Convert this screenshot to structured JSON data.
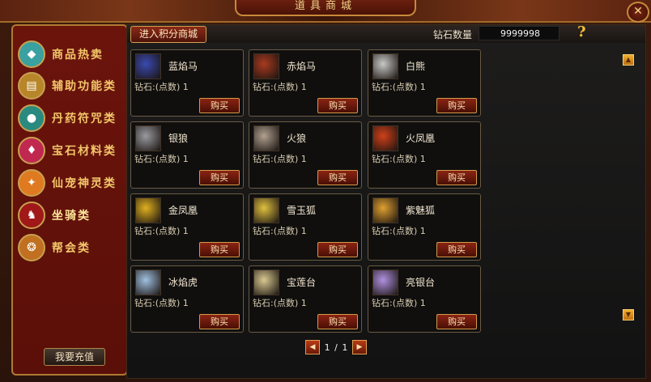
{
  "window": {
    "title": "道具商城",
    "close_glyph": "✕"
  },
  "sidebar": {
    "items": [
      {
        "label": "商品热卖",
        "icon": "gem-chest-icon",
        "color": "#3aa0a0"
      },
      {
        "label": "辅助功能类",
        "icon": "book-icon",
        "color": "#b8862a"
      },
      {
        "label": "丹药符咒类",
        "icon": "orb-icon",
        "color": "#2a8a80"
      },
      {
        "label": "宝石材料类",
        "icon": "gem-icon",
        "color": "#c02850"
      },
      {
        "label": "仙宠神灵类",
        "icon": "phoenix-pet-icon",
        "color": "#e07a20"
      },
      {
        "label": "坐骑类",
        "icon": "dragon-mount-icon",
        "color": "#a01818",
        "active": true
      },
      {
        "label": "帮会类",
        "icon": "bag-icon",
        "color": "#c07020"
      }
    ],
    "recharge_label": "我要充值"
  },
  "header": {
    "points_mall_label": "进入积分商城",
    "diamond_label": "钻石数量",
    "diamond_value": "9999998",
    "help_glyph": "?"
  },
  "items": [
    {
      "name": "蓝焰马",
      "price": "钻石:(点数) 1",
      "buy": "购买",
      "thumb": "blue-flame-horse-icon",
      "color": "#3a4ab0"
    },
    {
      "name": "赤焰马",
      "price": "钻石:(点数) 1",
      "buy": "购买",
      "thumb": "red-flame-horse-icon",
      "color": "#a83a20"
    },
    {
      "name": "白熊",
      "price": "钻石:(点数) 1",
      "buy": "购买",
      "thumb": "white-bear-icon",
      "color": "#c8c8c8"
    },
    {
      "name": "银狼",
      "price": "钻石:(点数) 1",
      "buy": "购买",
      "thumb": "silver-wolf-icon",
      "color": "#9a9aa0"
    },
    {
      "name": "火狼",
      "price": "钻石:(点数) 1",
      "buy": "购买",
      "thumb": "fire-wolf-icon",
      "color": "#b0a090"
    },
    {
      "name": "火凤凰",
      "price": "钻石:(点数) 1",
      "buy": "购买",
      "thumb": "fire-phoenix-icon",
      "color": "#d0401a"
    },
    {
      "name": "金凤凰",
      "price": "钻石:(点数) 1",
      "buy": "购买",
      "thumb": "golden-phoenix-icon",
      "color": "#e0b020"
    },
    {
      "name": "雪玉狐",
      "price": "钻石:(点数) 1",
      "buy": "购买",
      "thumb": "snow-fox-icon",
      "color": "#e0c040"
    },
    {
      "name": "紫魅狐",
      "price": "钻石:(点数) 1",
      "buy": "购买",
      "thumb": "purple-fox-icon",
      "color": "#e0a030"
    },
    {
      "name": "冰焰虎",
      "price": "钻石:(点数) 1",
      "buy": "购买",
      "thumb": "ice-tiger-icon",
      "color": "#a0c0e0"
    },
    {
      "name": "宝莲台",
      "price": "钻石:(点数) 1",
      "buy": "购买",
      "thumb": "lotus-platform-icon",
      "color": "#d8c890"
    },
    {
      "name": "亮银台",
      "price": "钻石:(点数) 1",
      "buy": "购买",
      "thumb": "silver-platform-icon",
      "color": "#b090e0"
    }
  ],
  "pager": {
    "current": "1",
    "separator": "/",
    "total": "1",
    "prev_glyph": "◀",
    "next_glyph": "▶"
  },
  "scroll": {
    "up_glyph": "▲",
    "down_glyph": "▼"
  }
}
